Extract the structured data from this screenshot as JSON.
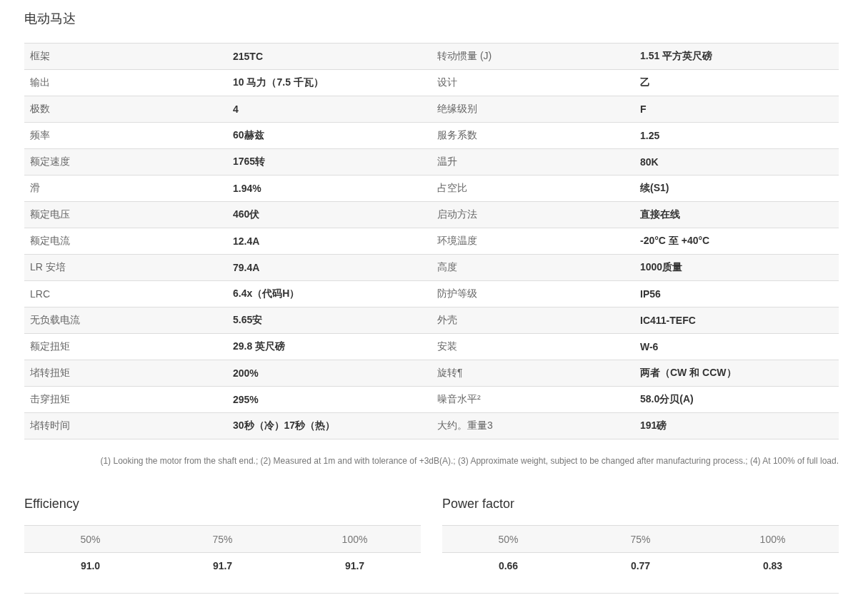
{
  "title": "电动马达",
  "specs": [
    {
      "label": "框架",
      "value": "215TC",
      "label_2": "转动惯量 (J)",
      "value_2": "1.51 平方英尺磅"
    },
    {
      "label": "输出",
      "value": "10 马力（7.5 千瓦）",
      "label_2": "设计",
      "value_2": "乙"
    },
    {
      "label": "极数",
      "value": "4",
      "label_2": "绝缘级别",
      "value_2": "F"
    },
    {
      "label": "频率",
      "value": "60赫兹",
      "label_2": "服务系数",
      "value_2": "1.25"
    },
    {
      "label": "额定速度",
      "value": "1765转",
      "label_2": "温升",
      "value_2": "80K"
    },
    {
      "label": "滑",
      "value": "1.94%",
      "label_2": "占空比",
      "value_2": "续(S1)"
    },
    {
      "label": "额定电压",
      "value": "460伏",
      "label_2": "启动方法",
      "value_2": "直接在线"
    },
    {
      "label": "额定电流",
      "value": "12.4A",
      "label_2": "环境温度",
      "value_2": "-20°C 至 +40°C"
    },
    {
      "label": "LR 安培",
      "value": "79.4A",
      "label_2": "高度",
      "value_2": "1000质量"
    },
    {
      "label": "LRC",
      "value": "6.4x（代码H）",
      "label_2": "防护等级",
      "value_2": "IP56"
    },
    {
      "label": "无负载电流",
      "value": "5.65安",
      "label_2": "外壳",
      "value_2": "IC411-TEFC"
    },
    {
      "label": "额定扭矩",
      "value": "29.8 英尺磅",
      "label_2": "安装",
      "value_2": "W-6"
    },
    {
      "label": "堵转扭矩",
      "value": "200%",
      "label_2": "旋转¶",
      "value_2": "两者（CW 和 CCW）"
    },
    {
      "label": "击穿扭矩",
      "value": "295%",
      "label_2": "噪音水平²",
      "value_2": "58.0分贝(A)"
    },
    {
      "label": "堵转时间",
      "value": "30秒（冷）17秒（热）",
      "label_2": "大约。重量3",
      "value_2": "191磅"
    }
  ],
  "footnote": "(1) Looking the motor from the shaft end.; (2) Measured at 1m and with tolerance of +3dB(A).; (3) Approximate weight, subject to be changed after manufacturing process.; (4) At 100% of full load.",
  "load_tables": [
    {
      "title": "Efficiency",
      "columns": [
        "50%",
        "75%",
        "100%"
      ],
      "values": [
        "91.0",
        "91.7",
        "91.7"
      ]
    },
    {
      "title": "Power factor",
      "columns": [
        "50%",
        "75%",
        "100%"
      ],
      "values": [
        "0.66",
        "0.77",
        "0.83"
      ]
    }
  ]
}
